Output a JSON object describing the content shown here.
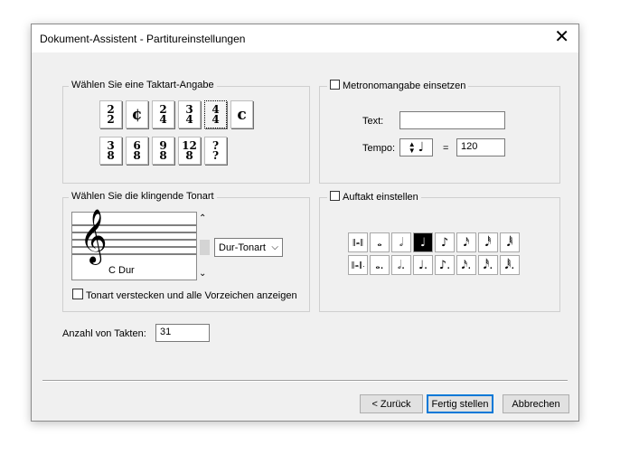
{
  "window": {
    "title": "Dokument-Assistent - Partitureinstellungen",
    "close_glyph": "✕"
  },
  "time_signature": {
    "legend": "Wählen Sie eine Taktart-Angabe",
    "row1": [
      {
        "num": "2",
        "den": "2"
      },
      {
        "symbol": "¢"
      },
      {
        "num": "2",
        "den": "4"
      },
      {
        "num": "3",
        "den": "4"
      },
      {
        "num": "4",
        "den": "4",
        "selected": true
      },
      {
        "symbol": "c"
      }
    ],
    "row2": [
      {
        "num": "3",
        "den": "8"
      },
      {
        "num": "6",
        "den": "8"
      },
      {
        "num": "9",
        "den": "8"
      },
      {
        "num": "12",
        "den": "8"
      },
      {
        "num": "?",
        "den": "?"
      }
    ]
  },
  "metronome": {
    "checkbox_label": "Metronomangabe einsetzen",
    "checked": false,
    "text_label": "Text:",
    "text_value": "",
    "tempo_label": "Tempo:",
    "equals": "=",
    "tempo_value": "120"
  },
  "key": {
    "legend": "Wählen Sie die klingende Tonart",
    "clef_glyph": "𝄞",
    "key_name": "C Dur",
    "mode_dropdown": "Dur-Tonart",
    "hide_checkbox_label": "Tonart verstecken und alle Vorzeichen anzeigen",
    "hide_checked": false
  },
  "pickup": {
    "checkbox_label": "Auftakt einstellen",
    "checked": false,
    "row1": [
      "‖𝅜‖",
      "𝅝",
      "𝅗𝅥",
      "♩",
      "♪",
      "𝅘𝅥𝅯",
      "𝅘𝅥𝅰",
      "𝅘𝅥𝅱"
    ],
    "row2": [
      "‖𝅜‖.",
      "𝅝.",
      "𝅗𝅥.",
      "♩.",
      "♪.",
      "𝅘𝅥𝅯.",
      "𝅘𝅥𝅰.",
      "𝅘𝅥𝅱."
    ],
    "selected_index": 3
  },
  "measures": {
    "label": "Anzahl von Takten:",
    "value": "31"
  },
  "buttons": {
    "back": "< Zurück",
    "finish": "Fertig stellen",
    "cancel": "Abbrechen"
  }
}
